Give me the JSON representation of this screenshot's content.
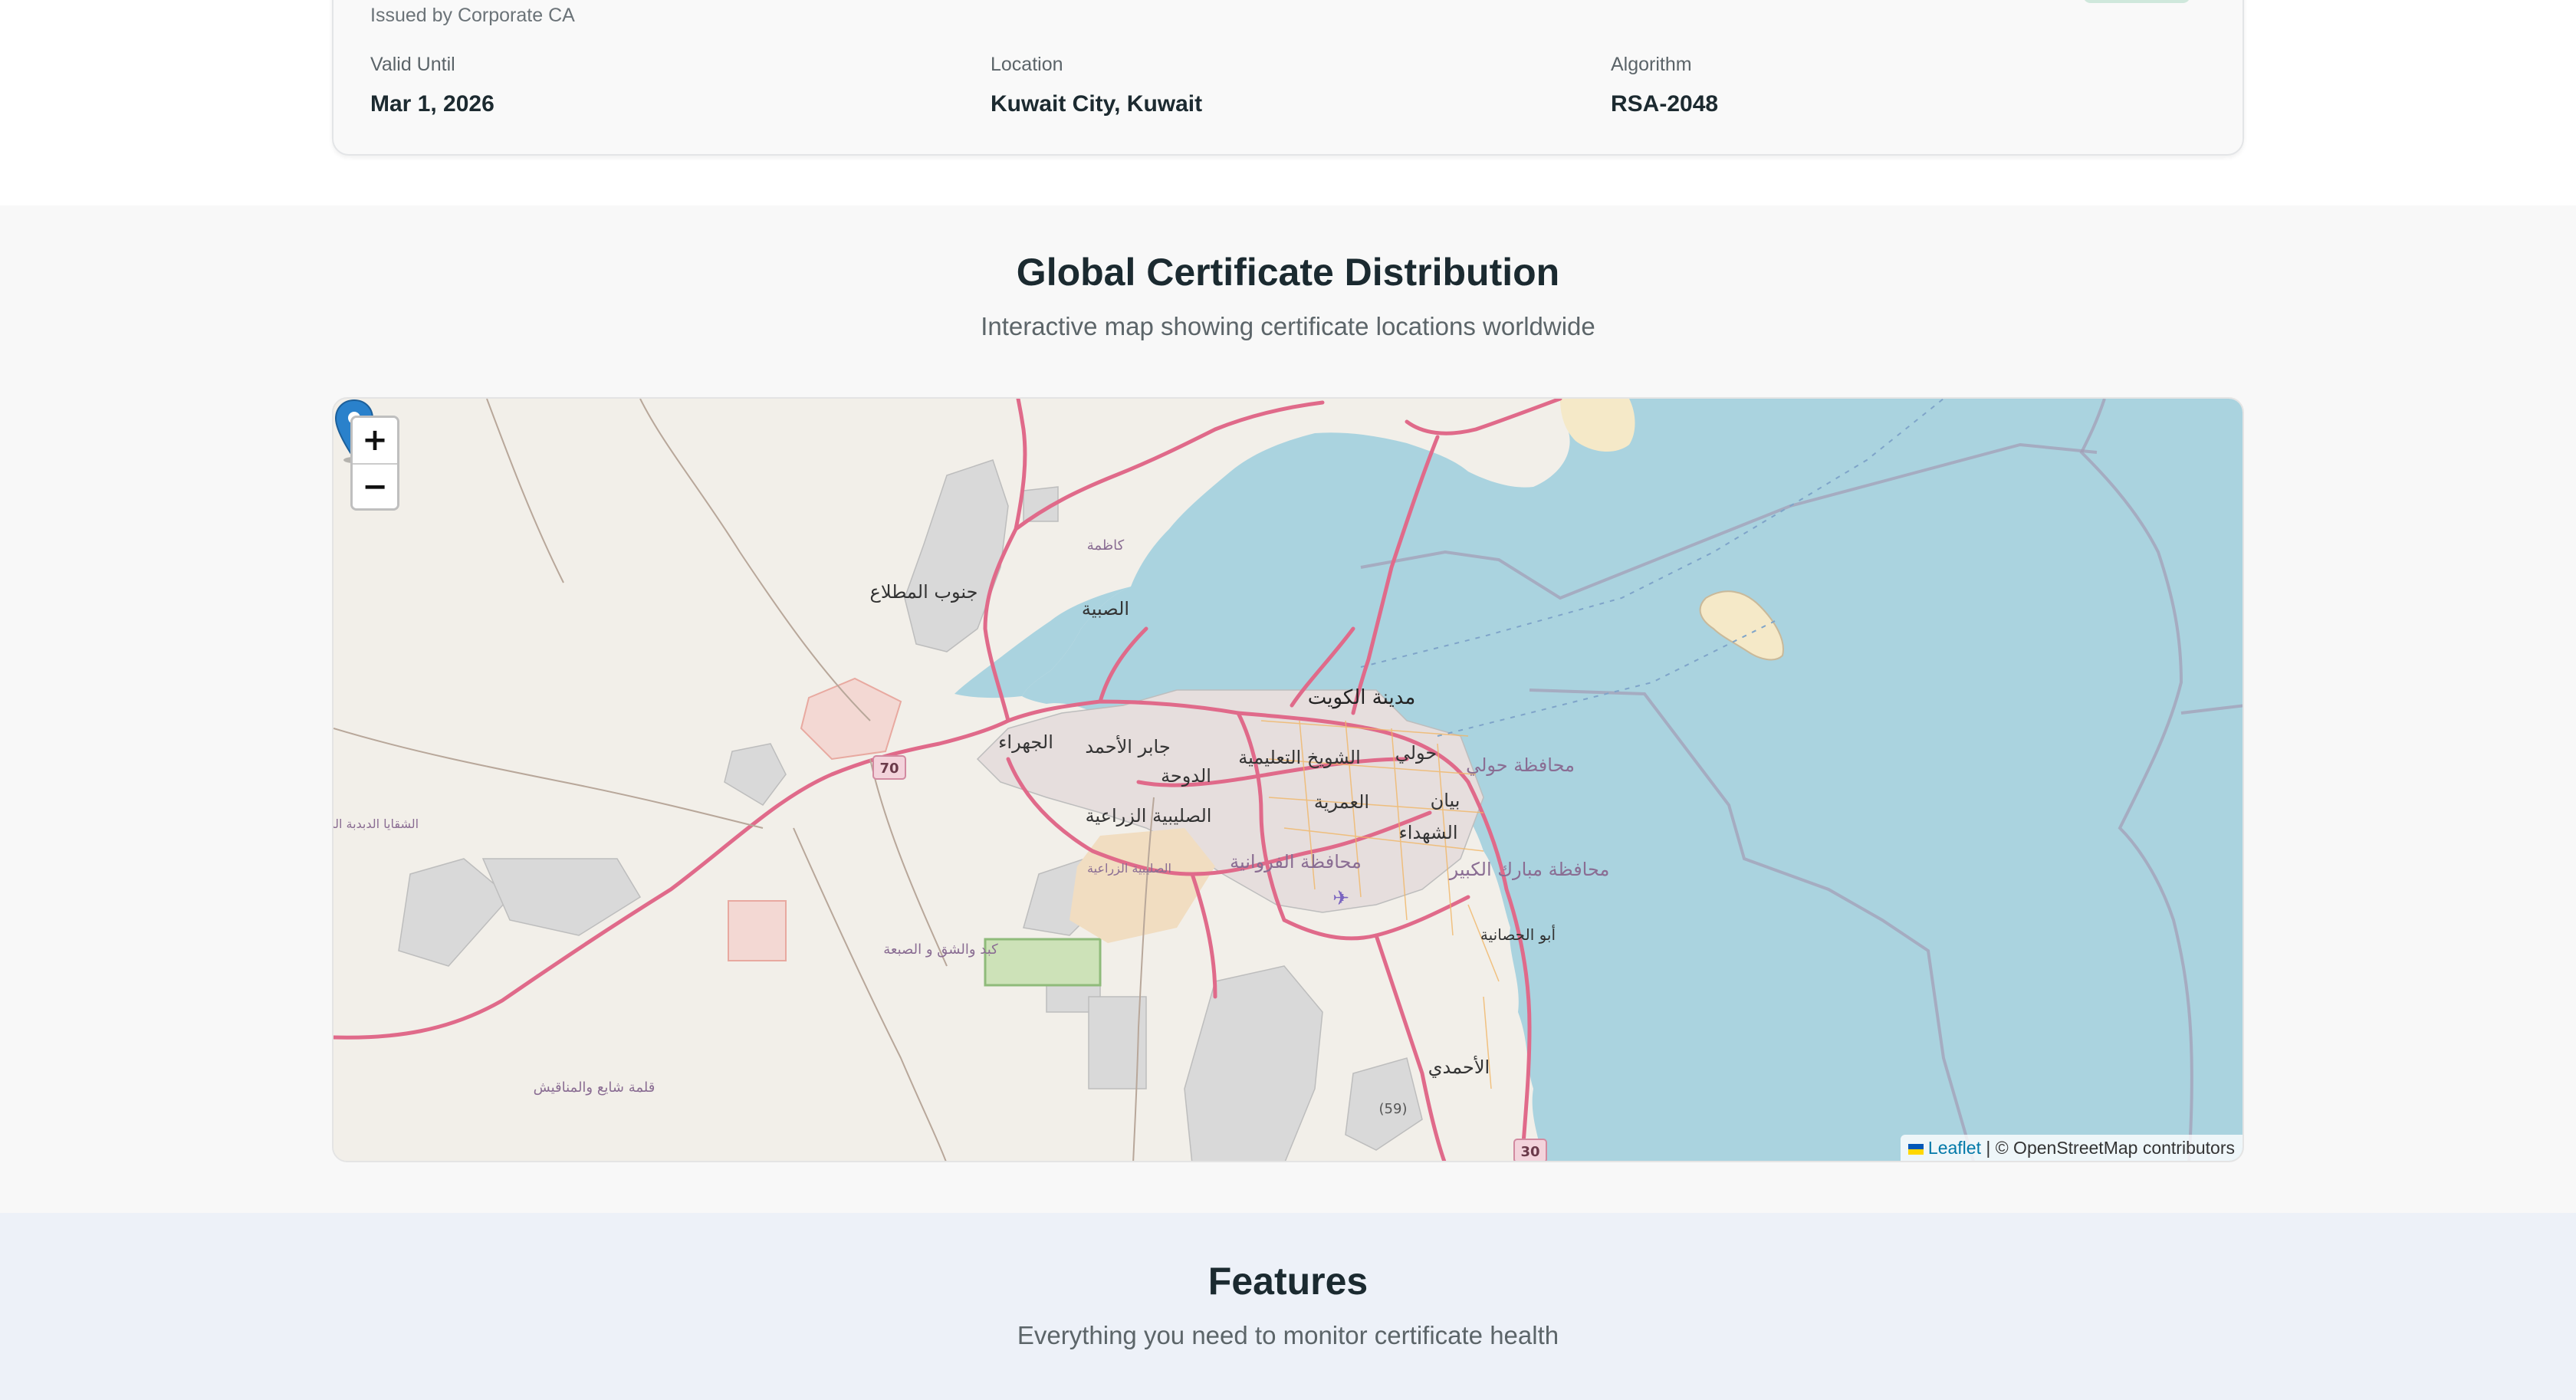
{
  "certificate": {
    "issued_by": "Issued by Corporate CA",
    "fields": [
      {
        "label": "Valid Until",
        "value": "Mar 1, 2026"
      },
      {
        "label": "Location",
        "value": "Kuwait City, Kuwait"
      },
      {
        "label": "Algorithm",
        "value": "RSA-2048"
      }
    ]
  },
  "map_section": {
    "title": "Global Certificate Distribution",
    "subtitle": "Interactive map showing certificate locations worldwide",
    "zoom_in": "+",
    "zoom_out": "−",
    "attribution_link": "Leaflet",
    "attribution_rest": " | © OpenStreetMap contributors",
    "marker_place": "مدينة الكويت",
    "place_labels": [
      "جنوب المطلاع",
      "الصبية",
      "كاظمة",
      "الجهراء",
      "جابر الأحمد",
      "الدوحة",
      "الشويخ التعليمية",
      "حولي",
      "محافظة حولي",
      "العمرية",
      "بيان",
      "الشهداء",
      "الصليبية الزراعية",
      "محافظة الفروانية",
      "محافظة مبارك الكبير",
      "أبو الحصانية",
      "كبد والشق و الصبعة",
      "قلمة شايع والمناقيش",
      "الأحمدي",
      "الشقايا الدبدبة المنياهيل",
      "الصليبية الزراعية"
    ],
    "road_shields": [
      "70",
      "30",
      "(59)"
    ],
    "colors": {
      "water": "#aad3df",
      "land": "#f2efe9",
      "road": "#e06a8a",
      "marker": "#2a81cb"
    }
  },
  "features": {
    "title": "Features",
    "subtitle": "Everything you need to monitor certificate health"
  }
}
